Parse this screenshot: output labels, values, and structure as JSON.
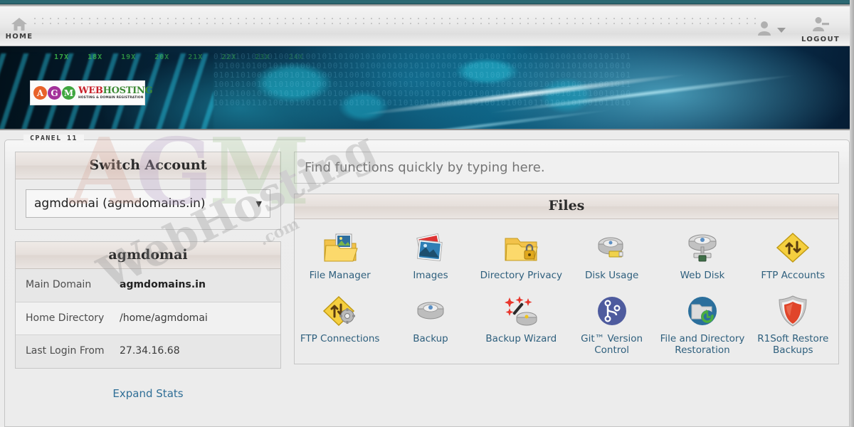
{
  "chrome": {
    "home_label": "HOME",
    "home_icon": "house-icon",
    "user_icon": "user-avatar-icon",
    "user_caret_icon": "chevron-down-icon",
    "logout_icon": "logout-person-icon",
    "logout_label": "LOGOUT"
  },
  "banner": {
    "ticks": [
      "17X",
      "18X",
      "19X",
      "20X",
      "21X",
      "22X",
      "23X",
      "24X"
    ],
    "binary": "01001010110100101001011010010100101101001010010110100101001011010010100101101\n10100101001011010010100101101001010010110100101001011010010100101101001010010\n01011010010100101101001010010110100101001011010010100101101001010010110100101\n10010100101101001010010110100101001011010010100101101001010010110100101001011\n01101001010010110100101001011010010100101101001010010110100101001011010010100\n10100101101001010010110100101001011010010100101101001010010110100101001011010",
    "logo": {
      "circles": [
        {
          "letter": "A",
          "color": "#e8622a"
        },
        {
          "letter": "G",
          "color": "#a3329a"
        },
        {
          "letter": "M",
          "color": "#3fa63f"
        }
      ],
      "word_web": "WEB",
      "word_hosting": "HOSTING",
      "web_color": "#c8202a",
      "hosting_color": "#3d8b35",
      "tagline": "HOSTING & DOMAIN REGISTRATION"
    }
  },
  "watermark": {
    "letters": [
      {
        "text": "A",
        "color": "#d8a89a"
      },
      {
        "text": "G",
        "color": "#b59ec4"
      },
      {
        "text": "M",
        "color": "#a8c79a"
      }
    ],
    "hosting_text": "WebHosting",
    "com_text": ".com"
  },
  "cpanel": {
    "legend": "CPANEL 11"
  },
  "switch_account": {
    "title": "Switch Account",
    "selected": "agmdomai (agmdomains.in)",
    "caret_icon": "select-caret-icon",
    "options": [
      "agmdomai (agmdomains.in)"
    ]
  },
  "stats": {
    "title": "agmdomai",
    "rows": [
      {
        "key": "Main Domain",
        "value": "agmdomains.in",
        "bold": true
      },
      {
        "key": "Home Directory",
        "value": "/home/agmdomai",
        "bold": false
      },
      {
        "key": "Last Login From",
        "value": "27.34.16.68",
        "bold": false
      }
    ],
    "expand_label": "Expand Stats"
  },
  "search": {
    "placeholder": "Find functions quickly by typing here.",
    "value": ""
  },
  "files": {
    "title": "Files",
    "items": [
      {
        "label": "File Manager",
        "icon": "file-manager-icon"
      },
      {
        "label": "Images",
        "icon": "images-icon"
      },
      {
        "label": "Directory Privacy",
        "icon": "directory-privacy-icon"
      },
      {
        "label": "Disk Usage",
        "icon": "disk-usage-icon"
      },
      {
        "label": "Web Disk",
        "icon": "web-disk-icon"
      },
      {
        "label": "FTP Accounts",
        "icon": "ftp-accounts-icon"
      },
      {
        "label": "FTP Connections",
        "icon": "ftp-connections-icon"
      },
      {
        "label": "Backup",
        "icon": "backup-icon"
      },
      {
        "label": "Backup Wizard",
        "icon": "backup-wizard-icon"
      },
      {
        "label": "Git™ Version Control",
        "icon": "git-version-control-icon"
      },
      {
        "label": "File and Directory Restoration",
        "icon": "file-directory-restoration-icon"
      },
      {
        "label": "R1Soft Restore Backups",
        "icon": "r1soft-restore-backups-icon"
      }
    ]
  },
  "colors": {
    "accent_teal": "#2d6b75",
    "link_blue": "#2f6e96",
    "caption_blue": "#2e5f7d"
  }
}
